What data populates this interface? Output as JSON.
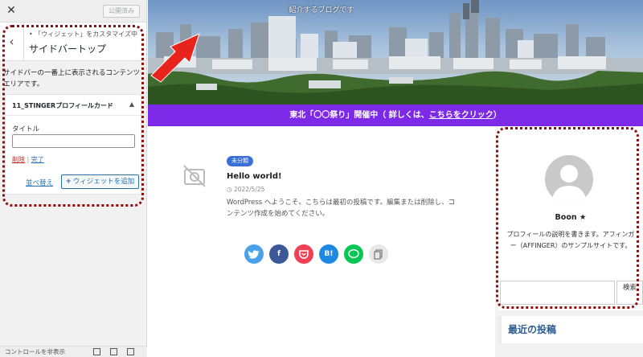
{
  "customizer": {
    "publish_label": "公開済み",
    "breadcrumb": "• 「ウィジェット」をカスタマイズ中",
    "section_title": "サイドバートップ",
    "description": "サイドバーの一番上に表示されるコンテンツエリアです。",
    "widget": {
      "name": "11_STINGERプロフィールカード",
      "field_label": "タイトル",
      "title_value": "",
      "delete_label": "削除",
      "separator": " | ",
      "done_label": "完了"
    },
    "reorder_label": "並べ替え",
    "add_widget_label": "ウィジェットを追加",
    "footer_label": "コントロールを非表示"
  },
  "site": {
    "tagline": "紹介するブログです",
    "notice": {
      "text": "東北「〇〇祭り」開催中（ 詳しくは、",
      "link": "こちらをクリック",
      "close": "）"
    },
    "post": {
      "category": "未分類",
      "title": "Hello world!",
      "date": "2022/5/25",
      "excerpt": "WordPress へようこそ。こちらは最初の投稿です。編集または削除し、コンテンツ作成を始めてください。"
    },
    "share_buttons": [
      {
        "name": "twitter",
        "label": "",
        "color": "#4aa1eb"
      },
      {
        "name": "facebook",
        "label": "f",
        "color": "#3b5998"
      },
      {
        "name": "pocket",
        "label": "",
        "color": "#ef4056"
      },
      {
        "name": "hatena",
        "label": "B!",
        "color": "#1e88e5"
      },
      {
        "name": "line",
        "label": "",
        "color": "#06c755"
      },
      {
        "name": "copy",
        "label": "",
        "color": "#e8e8e8"
      }
    ],
    "profile": {
      "name": "Boon ★",
      "text": "プロフィールの説明を書きます。アフィンガー（AFFINGER）のサンプルサイトです。"
    },
    "search_label": "検索",
    "recent_heading": "最近の投稿"
  },
  "colors": {
    "notice_bar": "#7c2ae8",
    "annotation": "#8b0d0d",
    "arrow": "#e8231c"
  }
}
